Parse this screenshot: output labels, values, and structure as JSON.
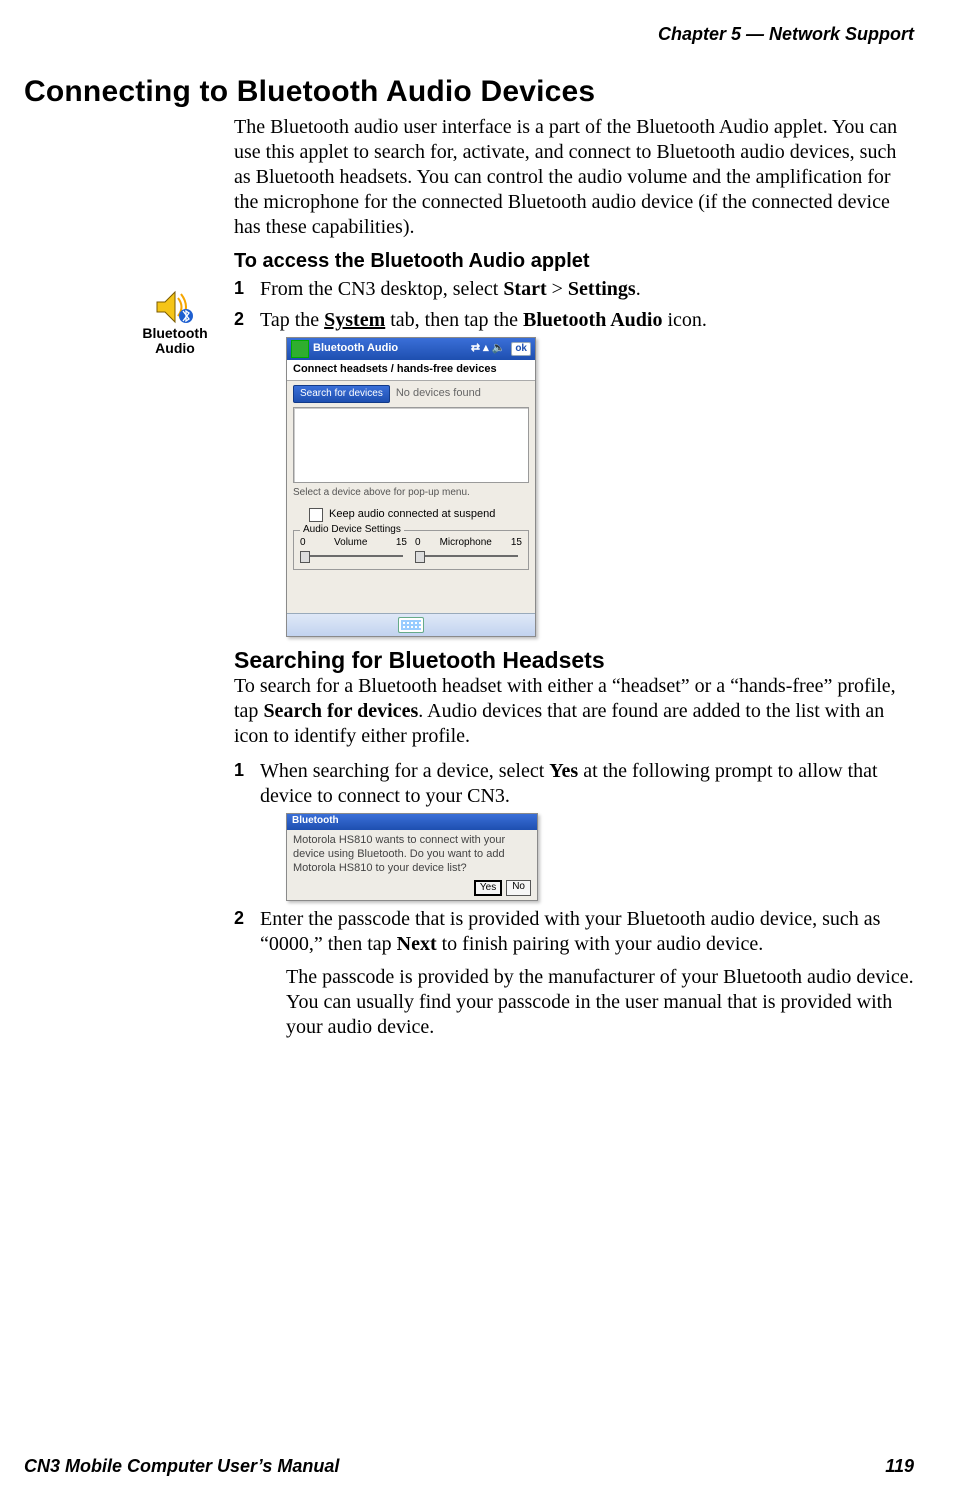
{
  "header": {
    "chapter": "Chapter 5 —  Network Support"
  },
  "section": {
    "title": "Connecting to Bluetooth Audio Devices",
    "intro": "The Bluetooth audio user interface is a part of the Bluetooth Audio applet. You can use this applet to search for, activate, and connect to Bluetooth audio devices, such as Bluetooth headsets. You can control the audio volume and the amplification for the microphone for the connected Bluetooth audio device (if the connected device has these capabilities).",
    "access_heading": "To access the Bluetooth Audio applet",
    "step1_a": "From the CN3 desktop, select ",
    "step1_b": "Start",
    "step1_c": " > ",
    "step1_d": "Settings",
    "step1_e": ".",
    "step2_a": "Tap the ",
    "step2_b": "System",
    "step2_c": " tab, then tap the ",
    "step2_d": "Bluetooth Audio",
    "step2_e": " icon."
  },
  "icon": {
    "line1": "Bluetooth",
    "line2": "Audio"
  },
  "shot1": {
    "title": "Bluetooth Audio",
    "ok": "ok",
    "strip": "Connect headsets / hands-free devices",
    "search_btn": "Search for devices",
    "no_devices": "No devices found",
    "hint": "Select a device above for pop-up menu.",
    "keep_audio": "Keep audio connected at suspend",
    "fieldset_legend": "Audio Device Settings",
    "vol_lo": "0",
    "vol_label": "Volume",
    "vol_hi": "15",
    "mic_lo": "0",
    "mic_label": "Microphone",
    "mic_hi": "15"
  },
  "searching": {
    "heading": "Searching for Bluetooth Headsets",
    "intro_a": "To search for a Bluetooth headset with either a “headset” or a “hands-free” profile, tap ",
    "intro_b": "Search for devices",
    "intro_c": ". Audio devices that are found are added to the list with an icon to identify either profile.",
    "step1_a": "When searching for a device, select ",
    "step1_b": "Yes",
    "step1_c": " at the following prompt to allow that device to connect to your CN3.",
    "step2_a": "Enter the passcode that is provided with your Bluetooth audio device, such as “0000,” then tap ",
    "step2_b": "Next",
    "step2_c": " to finish pairing with your audio device.",
    "step2_extra": "The passcode is provided by the manufacturer of your Bluetooth audio device. You can usually find your passcode in the user manual that is provided with your audio device."
  },
  "shot2": {
    "title": "Bluetooth",
    "msg": "Motorola HS810 wants to connect with your device using Bluetooth. Do you want to add Motorola HS810 to your device list?",
    "yes": "Yes",
    "no": "No"
  },
  "footer": {
    "left": "CN3 Mobile Computer User’s Manual",
    "right": "119"
  }
}
